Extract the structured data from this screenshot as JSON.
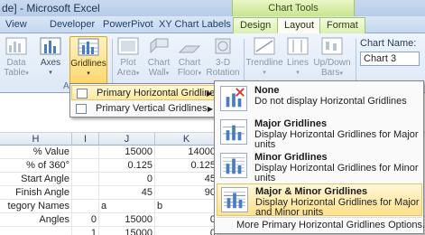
{
  "titlebar": {
    "title": "de] - Microsoft Excel",
    "chart_tools": "Chart Tools"
  },
  "tabs": [
    {
      "label": "View"
    },
    {
      "label": "Developer"
    },
    {
      "label": "PowerPivot"
    },
    {
      "label": "XY Chart Labels"
    },
    {
      "label": "Design"
    },
    {
      "label": "Layout"
    },
    {
      "label": "Format"
    }
  ],
  "ribbon": {
    "data_table": {
      "line1": "Data",
      "line2": "Table",
      "arrow": "▾"
    },
    "axes": {
      "label": "Axes",
      "arrow": "▾"
    },
    "gridlines": {
      "label": "Gridlines",
      "arrow": "▾"
    },
    "plot_area": {
      "line1": "Plot",
      "line2": "Area",
      "arrow": "▾"
    },
    "chart_wall": {
      "line1": "Chart",
      "line2": "Wall",
      "arrow": "▾"
    },
    "chart_floor": {
      "line1": "Chart",
      "line2": "Floor",
      "arrow": "▾"
    },
    "rotation_3d": {
      "line1": "3-D",
      "line2": "Rotation"
    },
    "trendline": {
      "label": "Trendline",
      "arrow": "▾"
    },
    "lines": {
      "label": "Lines",
      "arrow": "▾"
    },
    "updown_bars": {
      "line1": "Up/Down",
      "line2": "Bars",
      "arrow": "▾"
    },
    "chart_name_label": "Chart Name:",
    "chart_name_value": "Chart 3",
    "group_label": "A"
  },
  "gridlines_menu": {
    "items": [
      {
        "label": "Primary Horizontal Gridlines",
        "arrow": "▶"
      },
      {
        "label": "Primary Vertical Gridlines",
        "arrow": "▶"
      }
    ]
  },
  "submenu": {
    "options": [
      {
        "title": "None",
        "desc": "Do not display Horizontal Gridlines"
      },
      {
        "title": "Major Gridlines",
        "desc": "Display Horizontal Gridlines for Major units"
      },
      {
        "title": "Minor Gridlines",
        "desc": "Display Horizontal Gridlines for Minor units"
      },
      {
        "title": "Major & Minor Gridlines",
        "desc": "Display Horizontal Gridlines for Major and Minor units"
      }
    ],
    "more": "More Primary Horizontal Gridlines Options..."
  },
  "sheet": {
    "col_headers": [
      "H",
      "I",
      "J",
      "K"
    ],
    "rows": [
      [
        "% Value",
        "",
        "15000",
        "14000"
      ],
      [
        "% of 360°",
        "",
        "0.125",
        "0.125"
      ],
      [
        "Start Angle",
        "",
        "0",
        "45"
      ],
      [
        "Finish Angle",
        "",
        "45",
        "90"
      ],
      [
        "tegory Names",
        "",
        "a",
        "b"
      ],
      [
        "Angles",
        "0",
        "15000",
        "0"
      ],
      [
        "",
        "1",
        "15000",
        "0"
      ]
    ]
  },
  "colors": {
    "ribbon_bg": "#e4edf8",
    "hot": "#ffd56a",
    "chart_tools": "#c8e58f"
  }
}
